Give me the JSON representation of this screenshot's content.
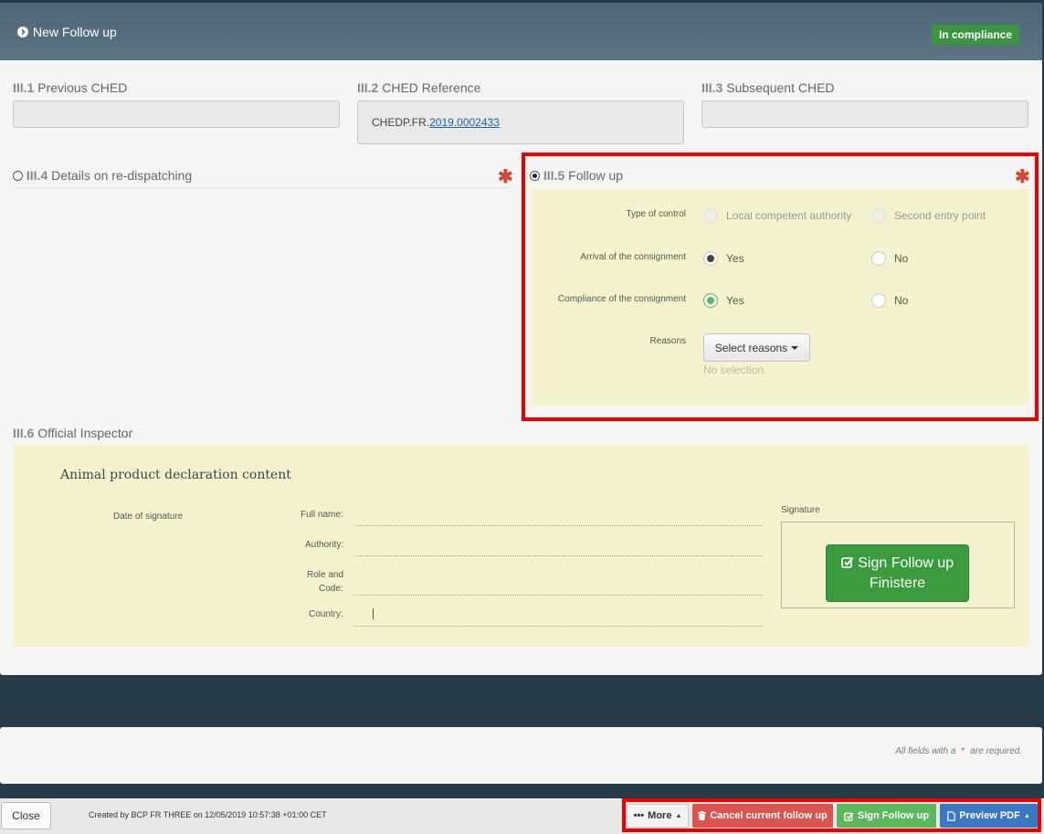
{
  "header": {
    "title": "New Follow up",
    "status_badge": "In compliance"
  },
  "fields": {
    "previous_ched": {
      "num": "III.1",
      "label": "Previous CHED",
      "value": ""
    },
    "ched_reference": {
      "num": "III.2",
      "label": "CHED Reference",
      "prefix": "CHEDP.FR.",
      "link": "2019.0002433"
    },
    "subsequent_ched": {
      "num": "III.3",
      "label": "Subsequent CHED",
      "value": ""
    }
  },
  "redispatch": {
    "num": "III.4",
    "label": "Details on re-dispatching",
    "required": "✱"
  },
  "follow_up": {
    "num": "III.5",
    "label": "Follow up",
    "required": "✱",
    "type_of_control": {
      "label": "Type of control",
      "options": [
        "Local competent authority",
        "Second entry point"
      ]
    },
    "arrival": {
      "label": "Arrival of the consignment",
      "options": [
        "Yes",
        "No"
      ],
      "selected": "Yes"
    },
    "compliance": {
      "label": "Compliance of the consignment",
      "options": [
        "Yes",
        "No"
      ],
      "selected": "Yes"
    },
    "reasons": {
      "label": "Reasons",
      "button": "Select reasons",
      "empty": "No selection."
    }
  },
  "inspector": {
    "num": "III.6",
    "label": "Official Inspector",
    "declaration_title": "Animal product declaration content",
    "date_of_signature": "Date of signature",
    "full_name": "Full name:",
    "authority": "Authority:",
    "role_line1": "Role and",
    "role_line2": "Code:",
    "country": "Country:",
    "signature": "Signature",
    "sign_button_line1": "Sign Follow up",
    "sign_button_line2": "Finistere"
  },
  "required_note": {
    "prefix": "All fields with a",
    "star": "*",
    "suffix": "are required."
  },
  "footer": {
    "close": "Close",
    "created": "Created by BCP FR THREE on 12/05/2019 10:57:38 +01:00 CET",
    "more": "More",
    "cancel": "Cancel current follow up",
    "sign": "Sign Follow up",
    "preview": "Preview PDF"
  },
  "colors": {
    "accent_green": "#3a9440",
    "danger": "#d9534f",
    "primary": "#3a78c3",
    "highlight": "#ee0000"
  }
}
